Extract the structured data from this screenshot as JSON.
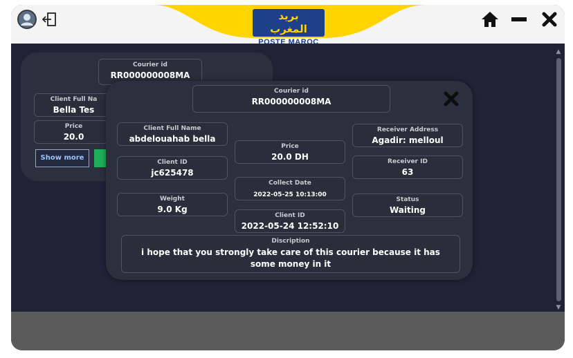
{
  "header": {
    "logo_arabic": "بريد المغرب",
    "logo_text": "POSTE MAROC",
    "icons": [
      "user-avatar-icon",
      "logout-icon",
      "home-icon",
      "minimize-icon",
      "close-icon"
    ]
  },
  "back_card": {
    "courier_id_label": "Courier id",
    "courier_id": "RR000000008MA",
    "client_full_name_label": "Client Full Na",
    "client_full_name": "Bella Tes",
    "price_label": "Price",
    "price": "20.0",
    "show_more_label": "Show more"
  },
  "detail": {
    "courier_id_label": "Courier id",
    "courier_id": "RR000000008MA",
    "client_full_name_label": "Client Full Name",
    "client_full_name": "abdelouahab bella",
    "client_id_label": "Client ID",
    "client_id": "jc625478",
    "weight_label": "Weight",
    "weight": "9.0 Kg",
    "price_label": "Price",
    "price": "20.0 DH",
    "collect_date_label": "Collect Date",
    "collect_date": "2022-05-25 10:13:00",
    "client_id2_label": "Client ID",
    "client_id2": "2022-05-24 12:52:10",
    "receiver_address_label": "Receiver Address",
    "receiver_address": "Agadir: melloul",
    "receiver_id_label": "Receiver ID",
    "receiver_id": "63",
    "status_label": "Status",
    "status": "Waiting",
    "description_label": "Discription",
    "description": "i hope that you strongly take care of this courier because it has some money in it"
  },
  "colors": {
    "accent_yellow": "#ffd400",
    "brand_blue": "#1e3f8a",
    "panel_bg": "#1f2336",
    "card_bg": "#2c2f3e",
    "green": "#1faf5b"
  }
}
